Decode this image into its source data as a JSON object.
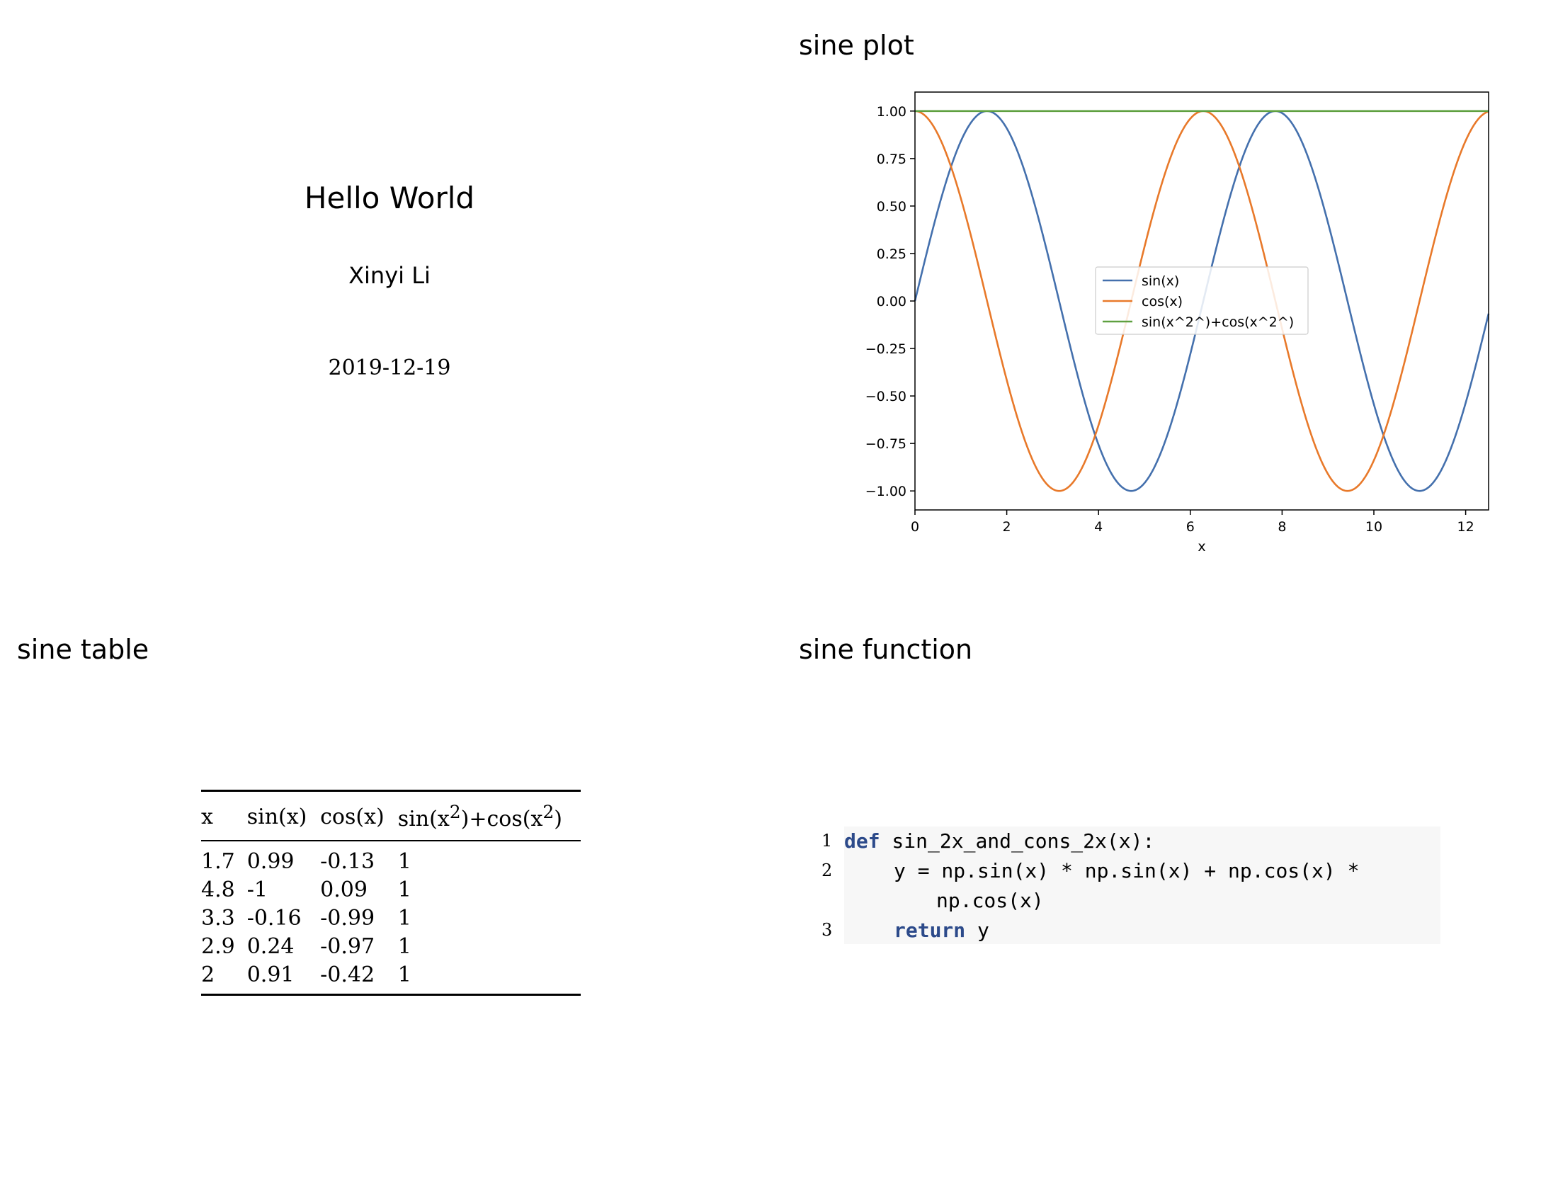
{
  "title_slide": {
    "title": "Hello World",
    "author": "Xinyi Li",
    "date": "2019-12-19"
  },
  "plot_section": {
    "heading": "sine plot"
  },
  "table_section": {
    "heading": "sine table",
    "columns": [
      "x",
      "sin(x)",
      "cos(x)",
      "sin(x2)+cos(x2)"
    ],
    "rows": [
      [
        "1.7",
        "0.99",
        "-0.13",
        "1"
      ],
      [
        "4.8",
        "-1",
        "0.09",
        "1"
      ],
      [
        "3.3",
        "-0.16",
        "-0.99",
        "1"
      ],
      [
        "2.9",
        "0.24",
        "-0.97",
        "1"
      ],
      [
        "2",
        "0.91",
        "-0.42",
        "1"
      ]
    ]
  },
  "code_section": {
    "heading": "sine function",
    "line_numbers": [
      "1",
      "2",
      "3"
    ],
    "line1_keyword": "def",
    "line1_rest": " sin_2x_and_cons_2x(x):",
    "line2": "y = np.sin(x) * np.sin(x) + np.cos(x) *",
    "line2_cont": "np.cos(x)",
    "line3_keyword": "return",
    "line3_rest": " y"
  },
  "chart_data": {
    "type": "line",
    "title": "",
    "xlabel": "x",
    "ylabel": "",
    "xlim": [
      0,
      12.5
    ],
    "ylim": [
      -1.1,
      1.1
    ],
    "xticks": [
      0,
      2,
      4,
      6,
      8,
      10,
      12
    ],
    "yticks": [
      1.0,
      0.75,
      0.5,
      0.25,
      0.0,
      -0.25,
      -0.5,
      -0.75,
      -1.0
    ],
    "ytick_labels": [
      "1.00",
      "0.75",
      "0.50",
      "0.25",
      "0.00",
      "−0.25",
      "−0.50",
      "−0.75",
      "−1.00"
    ],
    "grid": false,
    "legend_position": "center",
    "series": [
      {
        "name": "sin(x)",
        "function": "sin",
        "color": "#4470ad"
      },
      {
        "name": "cos(x)",
        "function": "cos",
        "color": "#e8792a"
      },
      {
        "name": "sin(x^2^)+cos(x^2^)",
        "function": "one",
        "color": "#5fa040"
      }
    ],
    "sampled_points": {
      "x": [
        0,
        1,
        2,
        3,
        4,
        5,
        6,
        7,
        8,
        9,
        10,
        11,
        12,
        12.5
      ],
      "sin": [
        0,
        0.84,
        0.91,
        0.14,
        -0.76,
        -0.96,
        -0.28,
        0.66,
        0.99,
        0.41,
        -0.54,
        -1.0,
        -0.54,
        -0.07
      ],
      "cos": [
        1,
        0.54,
        -0.42,
        -0.99,
        -0.65,
        0.28,
        0.96,
        0.75,
        -0.15,
        -0.91,
        -0.84,
        0.0,
        0.84,
        1.0
      ],
      "one": [
        1,
        1,
        1,
        1,
        1,
        1,
        1,
        1,
        1,
        1,
        1,
        1,
        1,
        1
      ]
    }
  }
}
